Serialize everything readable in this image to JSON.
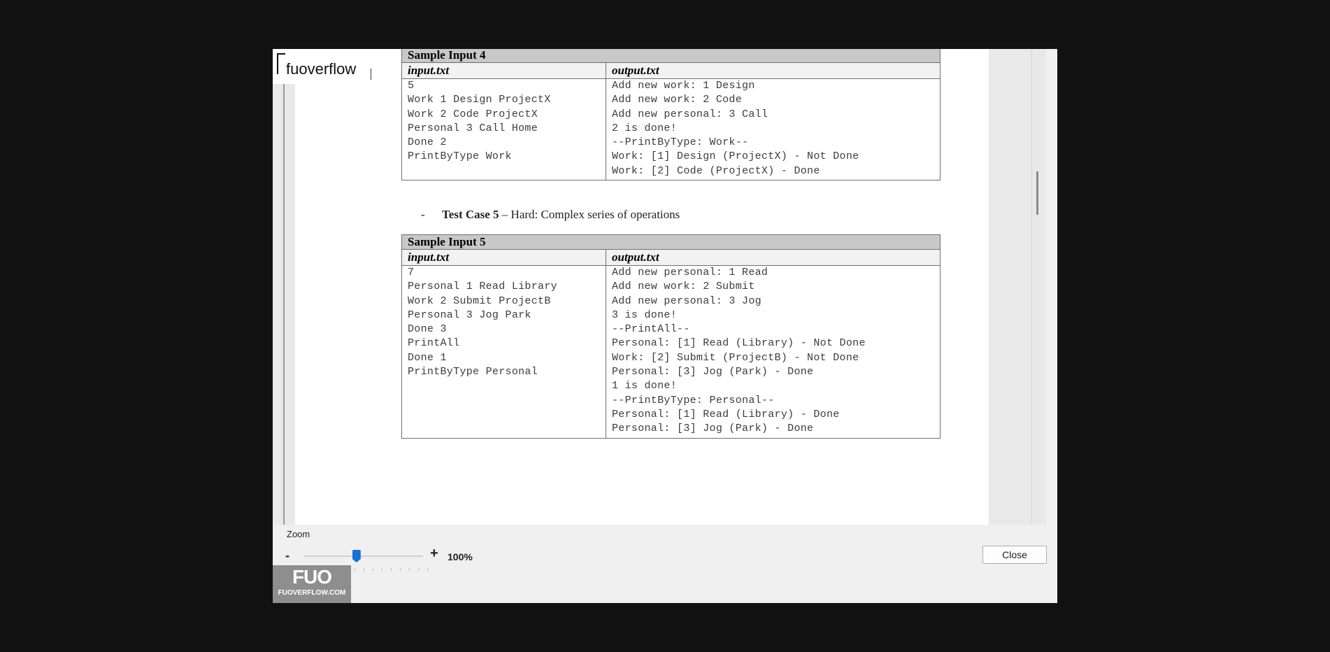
{
  "logo": {
    "text": "fuoverflow"
  },
  "sample4": {
    "title": "Sample Input 4",
    "input_header": "input.txt",
    "output_header": "output.txt",
    "input_lines": "5\nWork 1 Design ProjectX\nWork 2 Code ProjectX\nPersonal 3 Call Home\nDone 2\nPrintByType Work",
    "output_lines": "Add new work: 1 Design\nAdd new work: 2 Code\nAdd new personal: 3 Call\n2 is done!\n--PrintByType: Work--\nWork: [1] Design (ProjectX) - Not Done\nWork: [2] Code (ProjectX) - Done"
  },
  "testcase5": {
    "bullet": "-",
    "title": "Test Case 5",
    "description": " – Hard: Complex series of operations"
  },
  "sample5": {
    "title": "Sample Input 5",
    "input_header": "input.txt",
    "output_header": "output.txt",
    "input_lines": "7\nPersonal 1 Read Library\nWork 2 Submit ProjectB\nPersonal 3 Jog Park\nDone 3\nPrintAll\nDone 1\nPrintByType Personal",
    "output_lines": "Add new personal: 1 Read\nAdd new work: 2 Submit\nAdd new personal: 3 Jog\n3 is done!\n--PrintAll--\nPersonal: [1] Read (Library) - Not Done\nWork: [2] Submit (ProjectB) - Not Done\nPersonal: [3] Jog (Park) - Done\n1 is done!\n--PrintByType: Personal--\nPersonal: [1] Read (Library) - Done\nPersonal: [3] Jog (Park) - Done"
  },
  "zoom": {
    "label": "Zoom",
    "minus": "-",
    "plus": "+",
    "value_text": "100%",
    "slider_fraction": 0.44
  },
  "close_label": "Close",
  "watermark": {
    "logo": "FUO",
    "site": "FUOVERFLOW.COM"
  },
  "colors": {
    "accent": "#1a6fd0",
    "header_gray": "#c8c8c8"
  }
}
